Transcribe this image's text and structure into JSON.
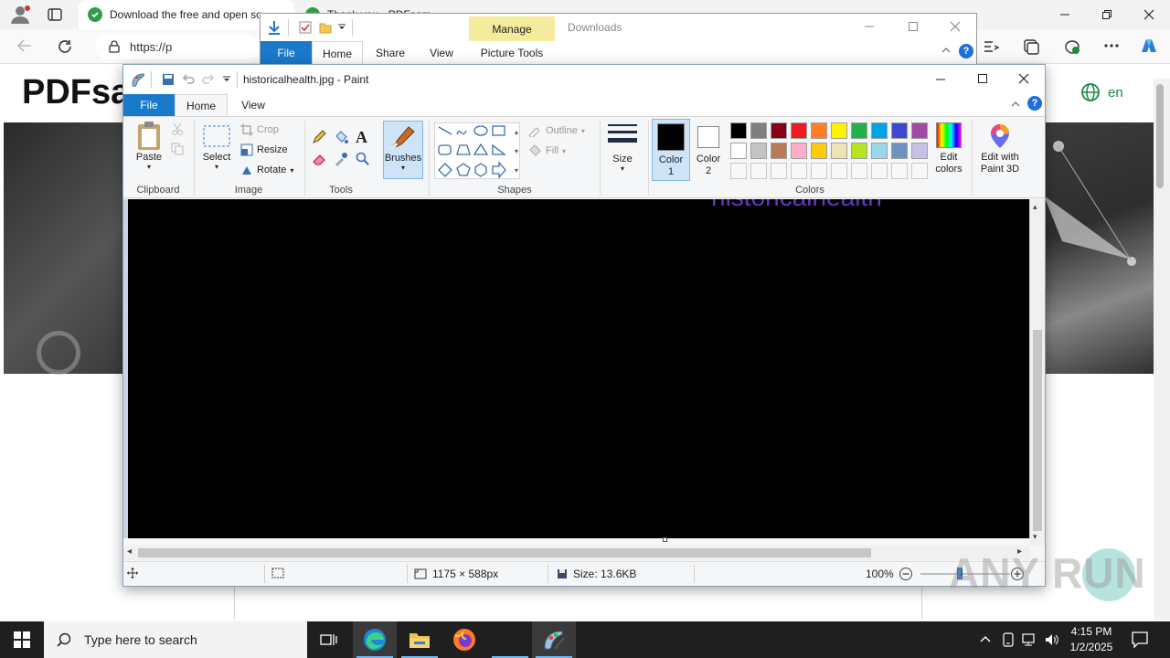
{
  "browser": {
    "tab1_title": "Download the free and open so",
    "tab2_title": "Thank you - PDFsam",
    "url": "https://p",
    "site_logo": "PDFsa",
    "lang": "en"
  },
  "explorer": {
    "manage_label": "Manage",
    "downloads_label": "Downloads",
    "tabs": [
      "File",
      "Home",
      "Share",
      "View",
      "Picture Tools"
    ]
  },
  "paint": {
    "title": "historicalhealth.jpg - Paint",
    "tabs": {
      "file": "File",
      "home": "Home",
      "view": "View"
    },
    "clipboard": {
      "paste": "Paste",
      "group": "Clipboard"
    },
    "image": {
      "select": "Select",
      "crop": "Crop",
      "resize": "Resize",
      "rotate": "Rotate",
      "group": "Image"
    },
    "tools": {
      "group": "Tools"
    },
    "brushes": "Brushes",
    "shapes": {
      "outline": "Outline",
      "fill": "Fill",
      "group": "Shapes"
    },
    "size": "Size",
    "color1": "Color 1",
    "color2": "Color 2",
    "colors_group": "Colors",
    "edit_colors": "Edit colors",
    "edit_paint3d": "Edit with Paint 3D",
    "palette_row1": [
      "#000000",
      "#7f7f7f",
      "#880015",
      "#ed1c24",
      "#ff7f27",
      "#fff200",
      "#22b14c",
      "#00a2e8",
      "#3f48cc",
      "#a349a4"
    ],
    "palette_row2": [
      "#ffffff",
      "#c3c3c3",
      "#b97a57",
      "#ffaec9",
      "#ffc90e",
      "#efe4b0",
      "#b5e61d",
      "#99d9ea",
      "#7092be",
      "#c8bfe7"
    ],
    "canvas_text": "historicalhealth",
    "status": {
      "dimensions": "1175 × 588px",
      "size": "Size: 13.6KB",
      "zoom": "100%"
    }
  },
  "taskbar": {
    "search_placeholder": "Type here to search",
    "time": "4:15 PM",
    "date": "1/2/2025"
  },
  "watermark": "ANY RUN"
}
